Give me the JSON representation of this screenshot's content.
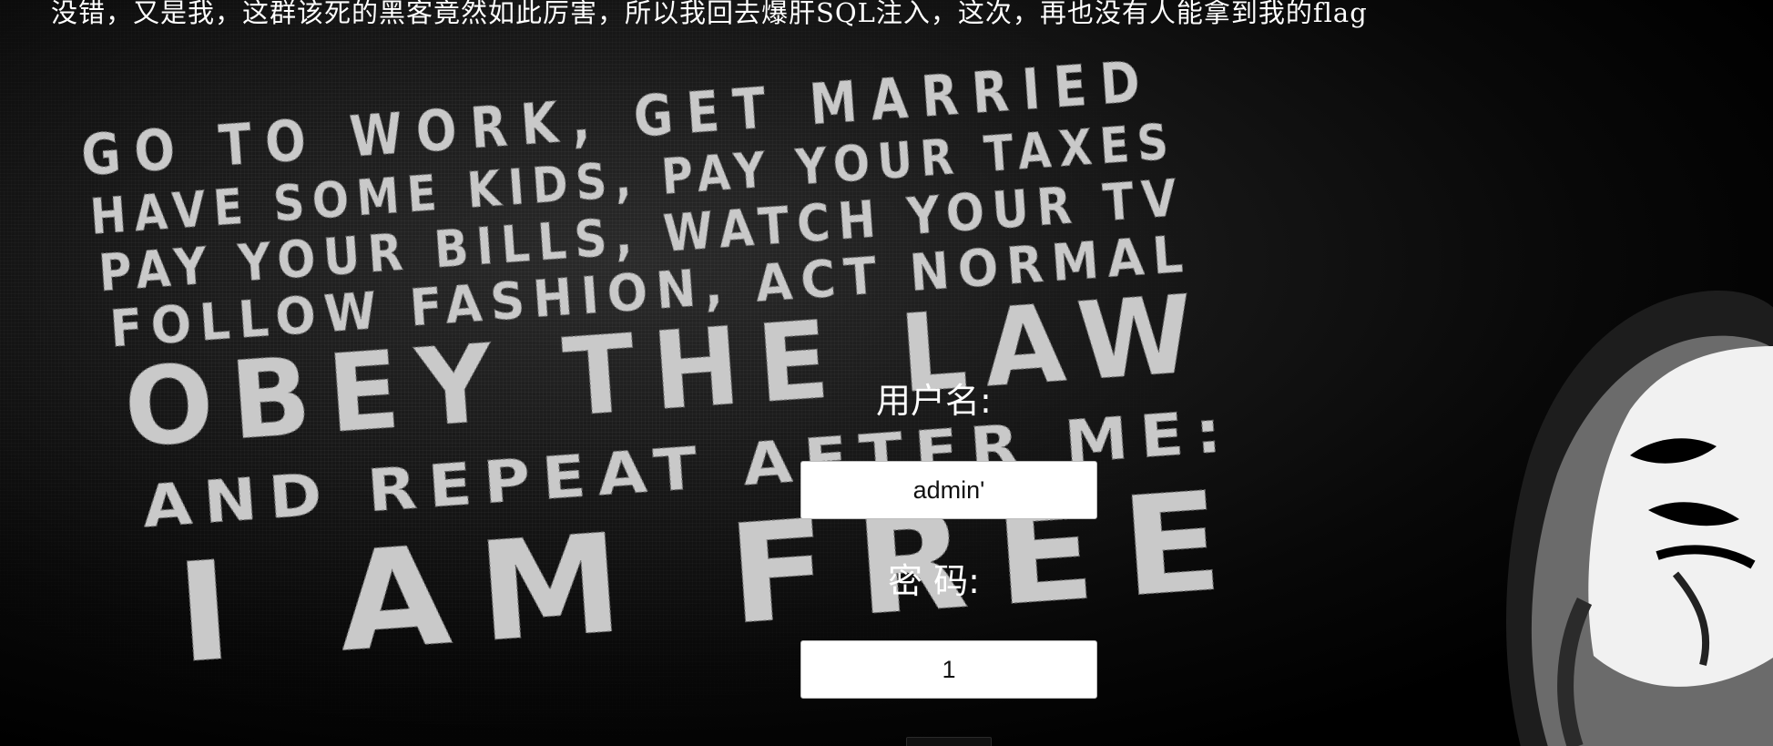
{
  "banner": {
    "text": "没错，又是我，这群该死的黑客竟然如此厉害，所以我回去爆肝SQL注入，这次，再也没有人能拿到我的flag"
  },
  "background_poster": {
    "lines": [
      "GO TO WORK, GET MARRIED",
      "HAVE SOME KIDS, PAY YOUR TAXES",
      "PAY YOUR BILLS, WATCH YOUR TV",
      "FOLLOW FASHION, ACT NORMAL",
      "OBEY THE LAW",
      "AND REPEAT AFTER ME:",
      "I AM FREE"
    ],
    "figure": "guy-fawkes-mask-icon"
  },
  "login_form": {
    "username_label": "用户名:",
    "username_value": "admin'",
    "password_label": "密 码:",
    "password_value": "1"
  },
  "colors": {
    "background": "#000000",
    "text": "#ffffff",
    "poster_text": "#c9c9c9",
    "input_background": "#ffffff"
  }
}
